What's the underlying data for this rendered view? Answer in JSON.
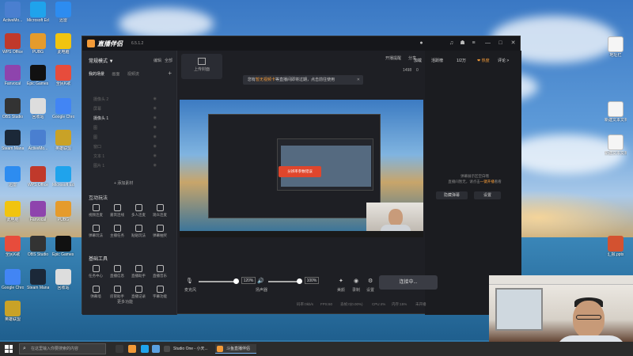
{
  "desktop": {
    "icons": [
      {
        "label": "ActiveMo...",
        "color": "#4a7fd0"
      },
      {
        "label": "WPS Office",
        "color": "#c0392b"
      },
      {
        "label": "Fanvocal",
        "color": "#8e44ad"
      },
      {
        "label": "OBS Studio",
        "color": "#333333"
      },
      {
        "label": "Steam Manager",
        "color": "#1b2838"
      },
      {
        "label": "迅雷",
        "color": "#2d8cf0"
      },
      {
        "label": "此电脑",
        "color": "#f1c40f"
      },
      {
        "label": "全民K歌",
        "color": "#e74c3c"
      },
      {
        "label": "Google Chrome",
        "color": "#4285f4"
      },
      {
        "label": "英雄联盟",
        "color": "#c9a227"
      },
      {
        "label": "Microsoft Edge",
        "color": "#1fa3ec"
      },
      {
        "label": "PUBG",
        "color": "#e59b2c"
      },
      {
        "label": "地址栏",
        "color": "#f5f5f5"
      },
      {
        "label": "Epic Games Launcher",
        "color": "#111111"
      },
      {
        "label": "回收站",
        "color": "#dddddd"
      },
      {
        "label": "新建文本文档",
        "color": "#f5f5f5"
      },
      {
        "label": "汇报.pptx",
        "color": "#d35230"
      }
    ]
  },
  "window": {
    "app_name": "直播伴侣",
    "version": "6.5.1.2",
    "controls": {
      "minimize": "—",
      "maximize": "□",
      "close": "✕"
    },
    "left_panel": {
      "mode_label": "常规模式 ▼",
      "edit_label": "编辑",
      "all_label": "全部",
      "tabs": [
        "我的场景",
        "画面",
        "视频流"
      ],
      "add_scene": "+",
      "scene_items": [
        "摄像头 2",
        "屏幕",
        "摄像头 1",
        "图",
        "图",
        "窗口",
        "文本 1",
        "图片 1"
      ],
      "add_source_label": "+ 添加素材",
      "interactive_title": "互动玩法",
      "interactive_tools": [
        "视频连麦",
        "嘉宾连线",
        "多人连麦",
        "观众连麦",
        "弹幕玩法",
        "主播任务",
        "贴贴玩法",
        "弹幕抽奖"
      ],
      "basic_tools_title": "基础工具",
      "basic_tools": [
        "任务中心",
        "直播信息",
        "直播助手",
        "直播音乐",
        "弹幕墙",
        "房管助手",
        "直播记录",
        "字幕功能"
      ],
      "more_label": "更多功能"
    },
    "upload_cover_label": "上传封面",
    "notice": {
      "prefix": "您有",
      "highlight": "暂无视频卡",
      "suffix": "等直播间即将过期，点击前往使用",
      "close": "✕"
    },
    "nested_banner": "分辨率参数错误",
    "right_panel": {
      "fans_label": "开播提醒",
      "share_label": "分享",
      "hot_label": "0",
      "count_label": "1498",
      "stats": [
        {
          "label": "加载",
          "hot": false
        },
        {
          "label": "活跃榜",
          "hot": false
        },
        {
          "label": "1/2万",
          "hot": false
        },
        {
          "label": "❤ 热度",
          "hot": true
        },
        {
          "label": "评论 >",
          "hot": false
        }
      ],
      "empty_hint_line1": "弹幕展示区空白哦",
      "empty_hint_line2_pre": "直播间暂无，请点击",
      "empty_hint_link": "一键开播",
      "empty_hint_line2_post": "看看",
      "btn_left": "隐藏弹幕",
      "btn_right": "设置"
    },
    "bottom": {
      "mic_label": "麦克风",
      "mic_pct": "120%",
      "speaker_label": "扬声器",
      "speaker_pct": "100%",
      "beauty_label": "美颜",
      "record_label": "录制",
      "settings_label": "设置",
      "connect_label": "连接中..."
    },
    "status_bar": [
      "码率:0kb/s",
      "FPS:60",
      "丢帧:0(0.00%)",
      "CPU:4%",
      "内存:15%",
      "未开播"
    ]
  },
  "taskbar": {
    "search_placeholder": "在这里输入你要搜索的内容",
    "items": [
      {
        "label": "Studio One - 小天...",
        "color": "#4a4a4a",
        "active": false
      },
      {
        "label": "斗鱼直播伴侣",
        "color": "#f29a38",
        "active": true
      }
    ]
  }
}
